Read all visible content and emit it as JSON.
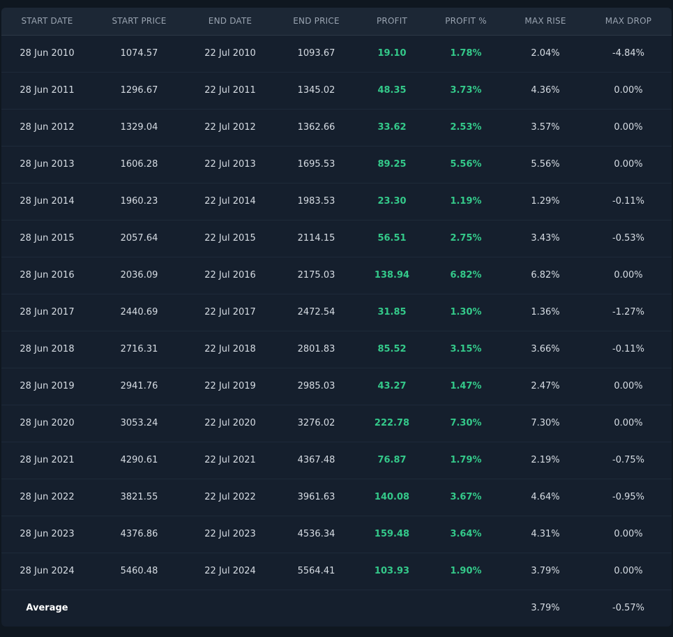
{
  "columns": [
    "START DATE",
    "START PRICE",
    "END DATE",
    "END PRICE",
    "PROFIT",
    "PROFIT %",
    "MAX RISE",
    "MAX DROP"
  ],
  "rows": [
    [
      "28 Jun 2010",
      "1074.57",
      "22 Jul 2010",
      "1093.67",
      "19.10",
      "1.78%",
      "2.04%",
      "-4.84%"
    ],
    [
      "28 Jun 2011",
      "1296.67",
      "22 Jul 2011",
      "1345.02",
      "48.35",
      "3.73%",
      "4.36%",
      "0.00%"
    ],
    [
      "28 Jun 2012",
      "1329.04",
      "22 Jul 2012",
      "1362.66",
      "33.62",
      "2.53%",
      "3.57%",
      "0.00%"
    ],
    [
      "28 Jun 2013",
      "1606.28",
      "22 Jul 2013",
      "1695.53",
      "89.25",
      "5.56%",
      "5.56%",
      "0.00%"
    ],
    [
      "28 Jun 2014",
      "1960.23",
      "22 Jul 2014",
      "1983.53",
      "23.30",
      "1.19%",
      "1.29%",
      "-0.11%"
    ],
    [
      "28 Jun 2015",
      "2057.64",
      "22 Jul 2015",
      "2114.15",
      "56.51",
      "2.75%",
      "3.43%",
      "-0.53%"
    ],
    [
      "28 Jun 2016",
      "2036.09",
      "22 Jul 2016",
      "2175.03",
      "138.94",
      "6.82%",
      "6.82%",
      "0.00%"
    ],
    [
      "28 Jun 2017",
      "2440.69",
      "22 Jul 2017",
      "2472.54",
      "31.85",
      "1.30%",
      "1.36%",
      "-1.27%"
    ],
    [
      "28 Jun 2018",
      "2716.31",
      "22 Jul 2018",
      "2801.83",
      "85.52",
      "3.15%",
      "3.66%",
      "-0.11%"
    ],
    [
      "28 Jun 2019",
      "2941.76",
      "22 Jul 2019",
      "2985.03",
      "43.27",
      "1.47%",
      "2.47%",
      "0.00%"
    ],
    [
      "28 Jun 2020",
      "3053.24",
      "22 Jul 2020",
      "3276.02",
      "222.78",
      "7.30%",
      "7.30%",
      "0.00%"
    ],
    [
      "28 Jun 2021",
      "4290.61",
      "22 Jul 2021",
      "4367.48",
      "76.87",
      "1.79%",
      "2.19%",
      "-0.75%"
    ],
    [
      "28 Jun 2022",
      "3821.55",
      "22 Jul 2022",
      "3961.63",
      "140.08",
      "3.67%",
      "4.64%",
      "-0.95%"
    ],
    [
      "28 Jun 2023",
      "4376.86",
      "22 Jul 2023",
      "4536.34",
      "159.48",
      "3.64%",
      "4.31%",
      "0.00%"
    ],
    [
      "28 Jun 2024",
      "5460.48",
      "22 Jul 2024",
      "5564.41",
      "103.93",
      "1.90%",
      "3.79%",
      "0.00%"
    ]
  ],
  "average": {
    "label": "Average",
    "max_rise": "3.79%",
    "max_drop": "-0.57%"
  },
  "colors": {
    "background": "#0f1720",
    "panel": "#151f2d",
    "header": "#1c2735",
    "positive": "#34c98a",
    "text": "#d7dde4",
    "header_text": "#9aa4b1"
  }
}
